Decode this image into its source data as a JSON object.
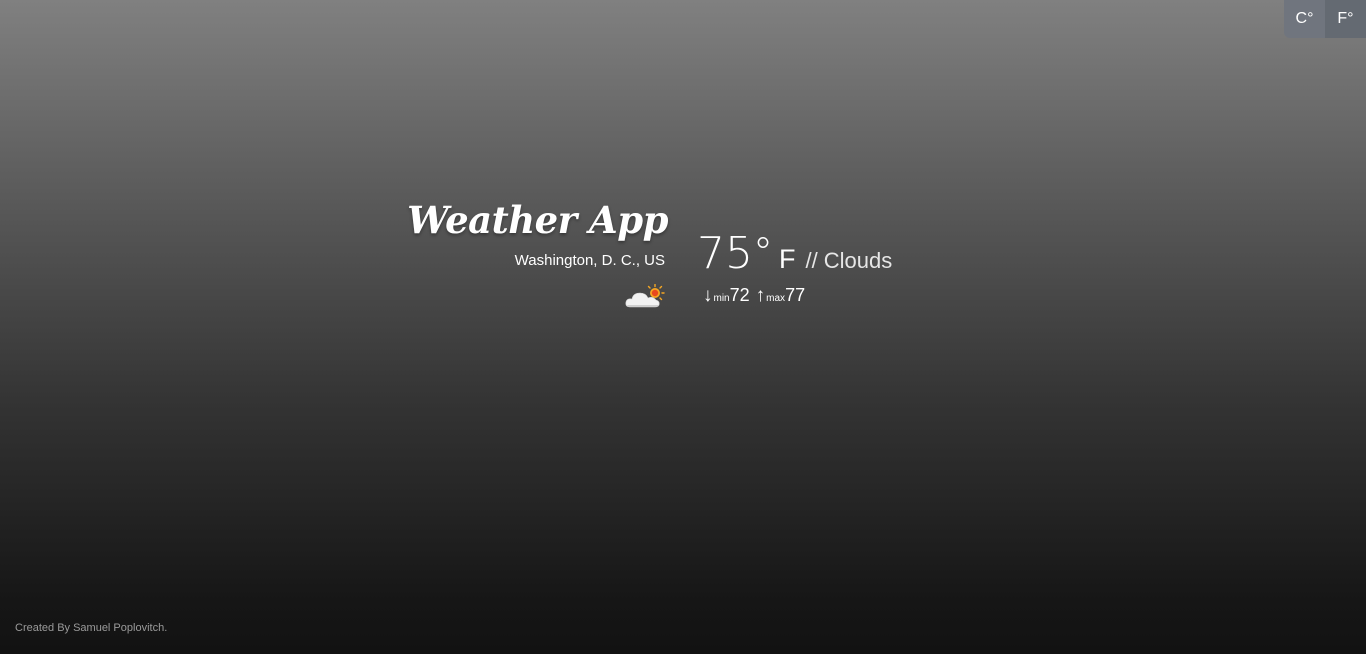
{
  "units": {
    "celsius_label": "C°",
    "fahrenheit_label": "F°"
  },
  "header": {
    "title": "Weather App",
    "location": "Washington, D. C., US"
  },
  "current": {
    "temperature": "75",
    "degree_symbol": "°",
    "unit": "F",
    "separator": "//",
    "condition": "Clouds",
    "icon": "cloud-sun-icon"
  },
  "range": {
    "min_label": "min",
    "min_value": "72",
    "max_label": "max",
    "max_value": "77",
    "min_icon": "arrow-down-icon",
    "max_icon": "arrow-up-icon"
  },
  "footer": {
    "credit": "Created By Samuel Poplovitch."
  },
  "colors": {
    "background_top": "#808080",
    "background_bottom": "#121212",
    "sun": "#f5a623"
  }
}
